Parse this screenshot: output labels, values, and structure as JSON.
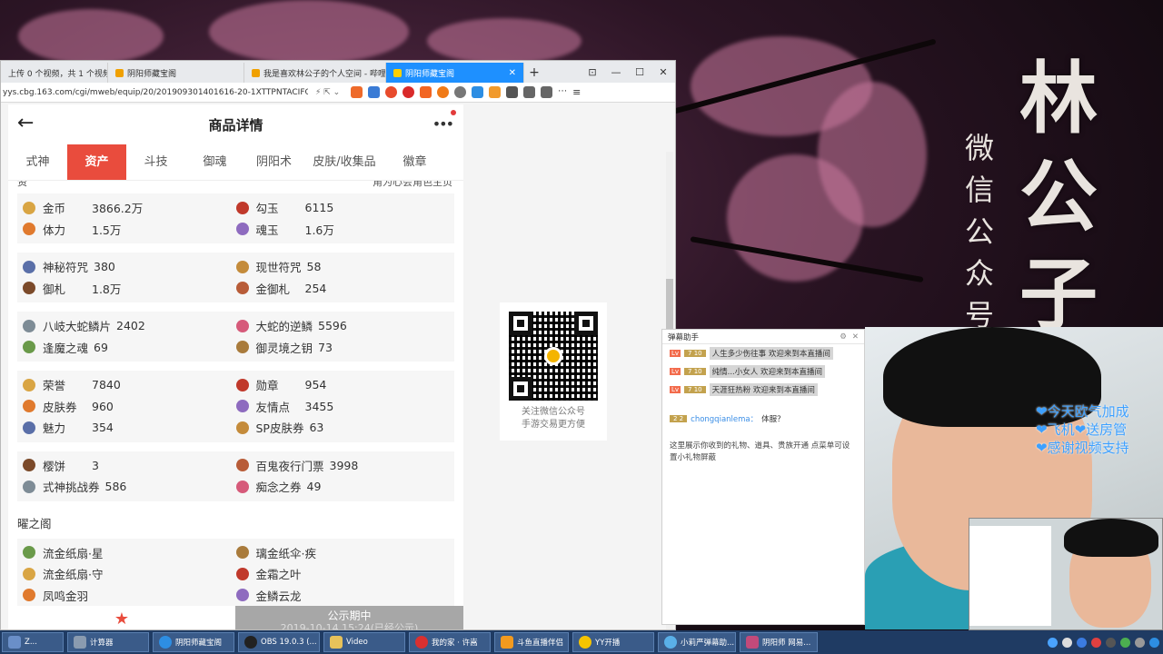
{
  "background": {
    "calligraphy": "林公子",
    "subtitle": "微信公众号"
  },
  "browser": {
    "tabs": [
      {
        "label": "上传 0 个视频，共 1 个视频 - 哔哩哔哩",
        "active": false
      },
      {
        "label": "阴阳师藏宝阁",
        "active": false
      },
      {
        "label": "我是喜欢林公子的个人空间 - 哔哩",
        "active": false
      },
      {
        "label": "阴阳师藏宝阁",
        "active": true
      }
    ],
    "url": "yys.cbg.163.com/cgi/mweb/equip/20/201909301401616-20-1XTTPNTACIFG"
  },
  "page": {
    "title": "商品详情",
    "tabs": [
      "式神",
      "资产",
      "斗技",
      "御魂",
      "阴阳术",
      "皮肤/收集品",
      "徽章"
    ],
    "active_tab": "资产",
    "partial_left": "资",
    "partial_right": "角为心会角色主页",
    "groups": [
      [
        [
          {
            "icon": "coin-icon",
            "label": "金币",
            "value": "3866.2万"
          },
          {
            "icon": "gouyu-icon",
            "label": "勾玉",
            "value": "6115"
          }
        ],
        [
          {
            "icon": "stamina-icon",
            "label": "体力",
            "value": "1.5万"
          },
          {
            "icon": "soul-jade-icon",
            "label": "魂玉",
            "value": "1.6万"
          }
        ]
      ],
      [
        [
          {
            "icon": "mystery-amulet-icon",
            "label": "神秘符咒",
            "value": "380"
          },
          {
            "icon": "present-amulet-icon",
            "label": "现世符咒",
            "value": "58"
          }
        ],
        [
          {
            "icon": "ofuda-icon",
            "label": "御札",
            "value": "1.8万"
          },
          {
            "icon": "gold-ofuda-icon",
            "label": "金御札",
            "value": "254"
          }
        ]
      ],
      [
        [
          {
            "icon": "orochi-scale-icon",
            "label": "八岐大蛇鳞片",
            "value": "2402"
          },
          {
            "icon": "orochi-reverse-scale-icon",
            "label": "大蛇的逆鳞",
            "value": "5596"
          }
        ],
        [
          {
            "icon": "demon-soul-icon",
            "label": "逢魔之魂",
            "value": "69"
          },
          {
            "icon": "spirit-key-icon",
            "label": "御灵境之钥",
            "value": "73"
          }
        ]
      ],
      [
        [
          {
            "icon": "honor-icon",
            "label": "荣誉",
            "value": "7840"
          },
          {
            "icon": "medal-icon",
            "label": "勋章",
            "value": "954"
          }
        ],
        [
          {
            "icon": "skin-ticket-icon",
            "label": "皮肤券",
            "value": "960"
          },
          {
            "icon": "friendship-icon",
            "label": "友情点",
            "value": "3455"
          }
        ],
        [
          {
            "icon": "charm-icon",
            "label": "魅力",
            "value": "354"
          },
          {
            "icon": "sp-skin-ticket-icon",
            "label": "SP皮肤券",
            "value": "63"
          }
        ]
      ],
      [
        [
          {
            "icon": "sakura-mochi-icon",
            "label": "樱饼",
            "value": "3"
          },
          {
            "icon": "night-parade-ticket-icon",
            "label": "百鬼夜行门票",
            "value": "3998"
          }
        ],
        [
          {
            "icon": "challenge-ticket-icon",
            "label": "式神挑战券",
            "value": "586"
          },
          {
            "icon": "obsession-ticket-icon",
            "label": "痴念之券",
            "value": "49"
          }
        ]
      ]
    ],
    "section_title": "曜之阁",
    "section_group": [
      [
        {
          "icon": "fan-star-icon",
          "label": "流金纸扇·星"
        },
        {
          "icon": "umbrella-icon",
          "label": "璃金纸伞·疾"
        }
      ],
      [
        {
          "icon": "fan-guard-icon",
          "label": "流金纸扇·守"
        },
        {
          "icon": "leaf-icon",
          "label": "金霜之叶"
        }
      ],
      [
        {
          "icon": "feather-icon",
          "label": "凤鸣金羽"
        },
        {
          "icon": "dragon-icon",
          "label": "金鳞云龙"
        }
      ]
    ],
    "notice_title": "公示期中",
    "notice_sub": "2019-10-14 15:24(已经公示)"
  },
  "qr": {
    "line1": "关注微信公众号",
    "line2": "手游交易更方便"
  },
  "danmu": {
    "title": "弹幕助手",
    "lines": [
      {
        "level": "Lv",
        "badge": "7 10",
        "text": "人生多少伤往事 欢迎来到本直播间"
      },
      {
        "level": "Lv",
        "badge": "7 10",
        "text": "纯情...小女人 欢迎来到本直播间"
      },
      {
        "level": "Lv",
        "badge": "7 10",
        "text": "天涯狂热粉 欢迎来到本直播间"
      }
    ],
    "chat_badge": "2 2",
    "chat_user": "chongqianlema：",
    "chat_text": "体服？",
    "info": "这里展示你收到的礼物、道具、贵族开通 点菜单可设置小礼物屏蔽"
  },
  "overlay": {
    "line1": "❤今天欧气加成",
    "line2": "❤飞机❤送房管",
    "line3": "❤感谢视频支持"
  },
  "taskbar": {
    "items": [
      "Z...",
      "计算器",
      "阴阳师藏宝阁",
      "OBS 19.0.3 (...",
      "Video",
      "我的家 · 许嵩",
      "斗鱼直播伴侣",
      "YY开播",
      "小莉严弹幕助...",
      "阴阳师 网易..."
    ]
  },
  "colors": {
    "accent": "#e94c3d",
    "browser_tab": "#1e90ff",
    "notice": "#a7a7a7",
    "overlay_text": "#3da0ff"
  }
}
